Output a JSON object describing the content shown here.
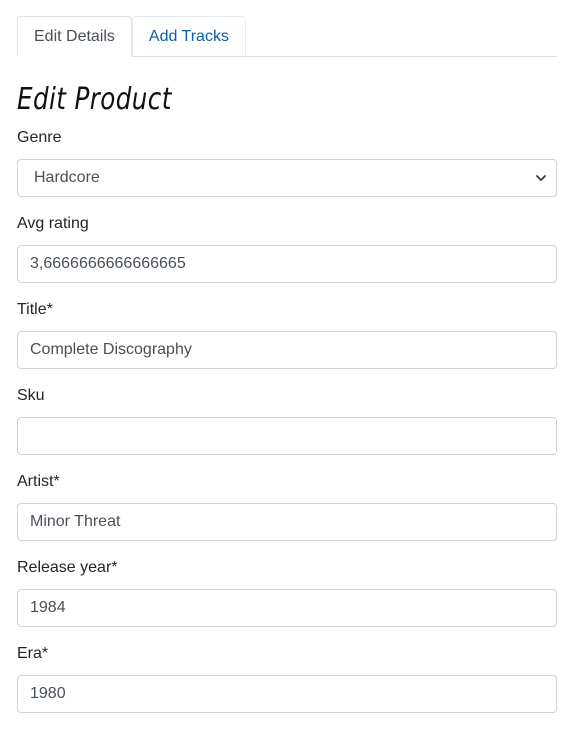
{
  "tabs": [
    {
      "label": "Edit Details",
      "active": true
    },
    {
      "label": "Add Tracks",
      "active": false
    }
  ],
  "page_title": "Edit Product",
  "fields": {
    "genre": {
      "label": "Genre",
      "value": "Hardcore"
    },
    "avg_rating": {
      "label": "Avg rating",
      "value": "3,6666666666666665"
    },
    "title": {
      "label": "Title*",
      "value": "Complete Discography"
    },
    "sku": {
      "label": "Sku",
      "value": ""
    },
    "artist": {
      "label": "Artist*",
      "value": "Minor Threat"
    },
    "release_year": {
      "label": "Release year*",
      "value": "1984"
    },
    "era": {
      "label": "Era*",
      "value": "1980"
    }
  },
  "colors": {
    "link": "#0d5ea8",
    "border": "#ced4da",
    "text": "#212529",
    "input_text": "#495057"
  },
  "icons": {
    "select_caret": "chevron-down-icon"
  }
}
